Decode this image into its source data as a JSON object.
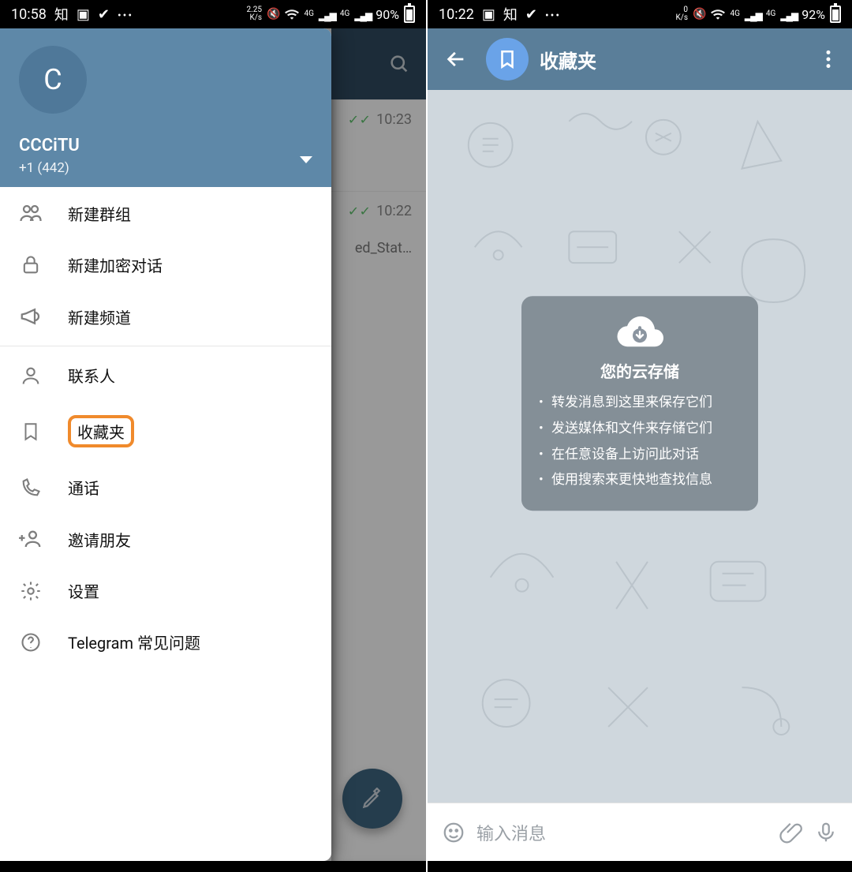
{
  "screenA": {
    "status": {
      "time": "10:58",
      "speed_top": "2.25",
      "speed_unit": "K/s",
      "net_label": "4G",
      "battery": "90%"
    },
    "chat_peek": {
      "rows": [
        {
          "read": true,
          "time": "10:23",
          "snippet": ""
        },
        {
          "read": true,
          "time": "10:22",
          "snippet": "ed_Stat…"
        }
      ]
    },
    "drawer": {
      "avatar_initial": "C",
      "account_name": "CCCiTU",
      "account_phone": "+1 (442)",
      "items": [
        {
          "icon": "group",
          "label": "新建群组"
        },
        {
          "icon": "lock",
          "label": "新建加密对话"
        },
        {
          "icon": "megaphone",
          "label": "新建频道"
        },
        {
          "icon": "person",
          "label": "联系人"
        },
        {
          "icon": "bookmark",
          "label": "收藏夹",
          "highlight": true
        },
        {
          "icon": "phone",
          "label": "通话"
        },
        {
          "icon": "invite",
          "label": "邀请朋友"
        },
        {
          "icon": "gear",
          "label": "设置"
        },
        {
          "icon": "help",
          "label": "Telegram 常见问题"
        }
      ]
    }
  },
  "screenB": {
    "status": {
      "time": "10:22",
      "speed_top": "0",
      "speed_unit": "K/s",
      "net_label": "4G",
      "battery": "92%"
    },
    "toolbar": {
      "title": "收藏夹"
    },
    "empty": {
      "title": "您的云存储",
      "bullets": [
        "转发消息到这里来保存它们",
        "发送媒体和文件来存储它们",
        "在任意设备上访问此对话",
        "使用搜索来更快地查找信息"
      ]
    },
    "input_placeholder": "输入消息"
  }
}
